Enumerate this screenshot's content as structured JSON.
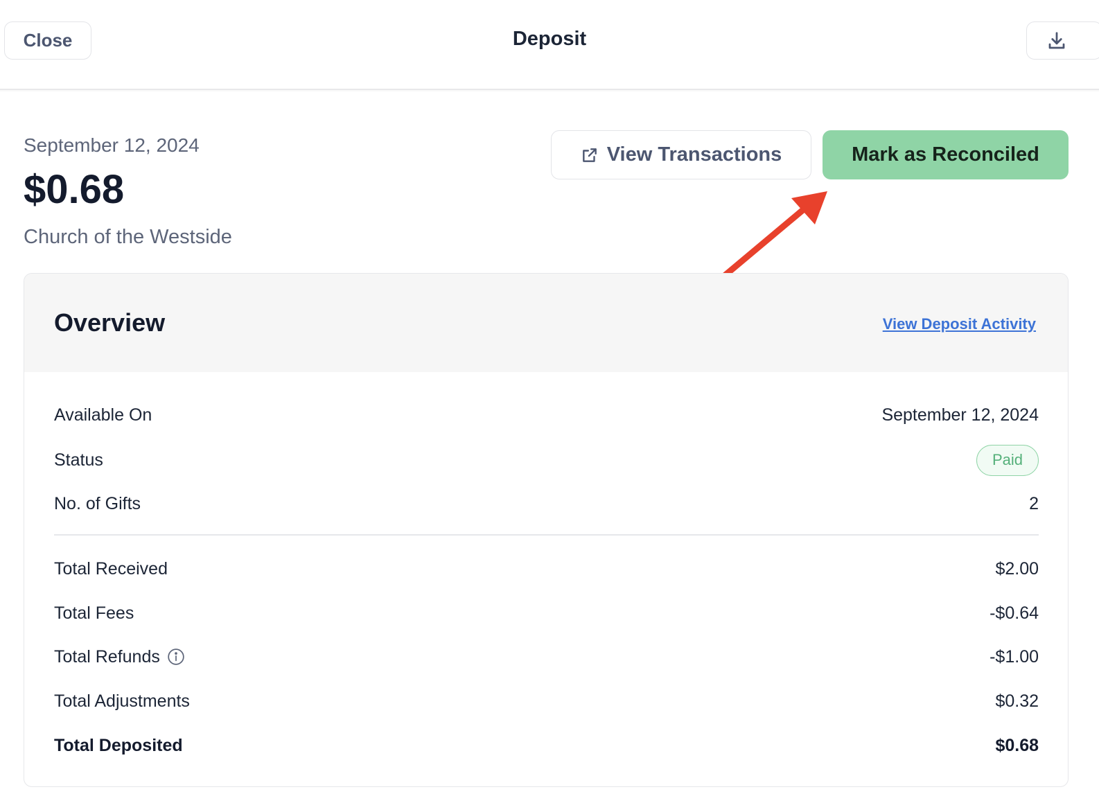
{
  "header": {
    "close_label": "Close",
    "title": "Deposit",
    "download_icon": "download-icon"
  },
  "summary": {
    "date": "September 12, 2024",
    "amount": "$0.68",
    "organization": "Church of the Westside"
  },
  "actions": {
    "view_transactions_label": "View Transactions",
    "view_transactions_icon": "external-link-icon",
    "reconcile_label": "Mark as Reconciled",
    "reconcile_color": "#8fd4a6"
  },
  "overview": {
    "title": "Overview",
    "activity_link": "View Deposit Activity",
    "details": [
      {
        "label": "Available On",
        "value": "September 12, 2024"
      },
      {
        "label": "Status",
        "value": "Paid"
      },
      {
        "label": "No. of Gifts",
        "value": "2"
      }
    ],
    "totals": [
      {
        "label": "Total Received",
        "value": "$2.00"
      },
      {
        "label": "Total Fees",
        "value": "-$0.64"
      },
      {
        "label": "Total Refunds",
        "value": "-$1.00"
      },
      {
        "label": "Total Adjustments",
        "value": "$0.32"
      },
      {
        "label": "Total Deposited",
        "value": "$0.68"
      }
    ]
  },
  "annotation": {
    "arrow_color": "#e8412c"
  }
}
